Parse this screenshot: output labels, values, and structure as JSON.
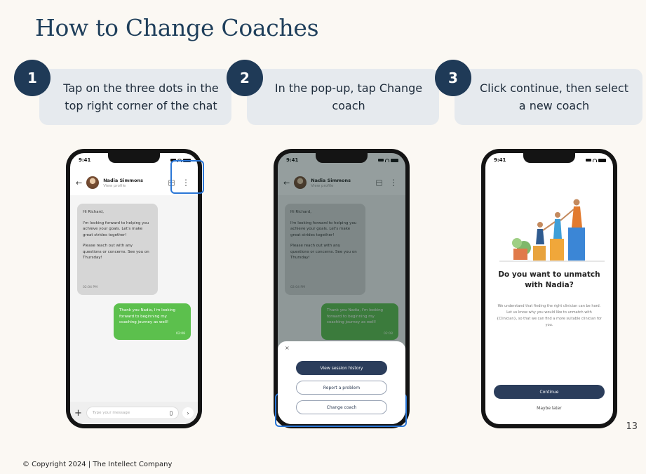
{
  "slide": {
    "title": "How to Change Coaches",
    "page_number": "13",
    "footer": "© Copyright 2024 | The Intellect Company"
  },
  "steps": [
    {
      "number": "1",
      "line1": "Tap on the three dots in the",
      "line2": "top right corner of the chat"
    },
    {
      "number": "2",
      "line1": "In the pop-up, tap Change",
      "line2": "coach"
    },
    {
      "number": "3",
      "line1": "Click continue, then select",
      "line2": "a new coach"
    }
  ],
  "phone_status_time": "9:41",
  "chat": {
    "coach_name": "Nadia Simmons",
    "coach_sub": "View profile",
    "incoming": {
      "greeting": "Hi Richard,",
      "para1": "I'm looking forward to helping you achieve your goals. Let's make great strides together!",
      "para2": "Please reach out with any questions or concerns. See you on Thursday!",
      "time": "02:04 PM"
    },
    "outgoing": {
      "text": "Thank you Nadia, I'm looking forward to beginning my coaching journey as well!",
      "time": "02:08"
    },
    "input_placeholder": "Type your message"
  },
  "sheet": {
    "close": "×",
    "buttons": [
      "View session history",
      "Report a problem",
      "Change coach"
    ]
  },
  "unmatch": {
    "title_line1": "Do you want to unmatch",
    "title_line2": "with Nadia?",
    "description": "We understand that finding the right clinician can be hard. Let us know why you would like to unmatch with {Clinician}, so that we can find a more suitable clinician for you.",
    "continue_label": "Continue",
    "later_label": "Maybe later"
  },
  "colors": {
    "accent_navy": "#1f3a57",
    "highlight_blue": "#2a76d6",
    "bubble_green": "#5cc04d"
  }
}
